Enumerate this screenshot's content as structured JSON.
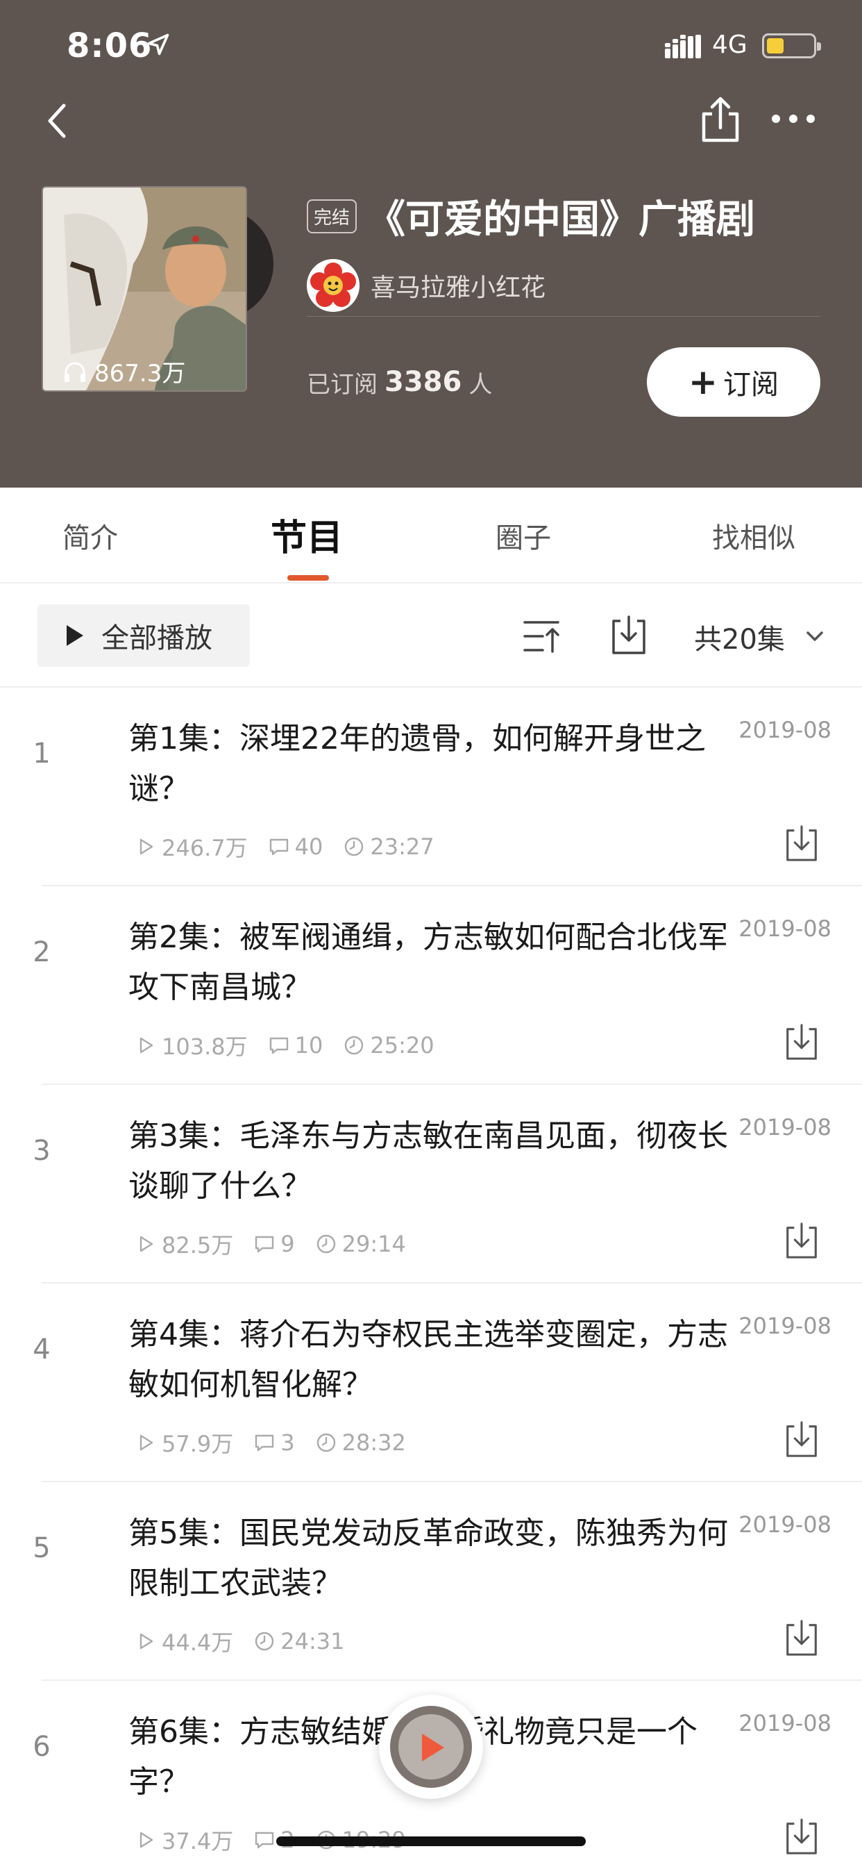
{
  "status_bar": {
    "time": "8:06",
    "network": "4G"
  },
  "album": {
    "status_badge": "完结",
    "title": "《可爱的中国》广播剧",
    "author": "喜马拉雅小红花",
    "plays": "867.3万",
    "subscribed_label": "已订阅",
    "subscribed_count": "3386",
    "subscribed_unit": "人",
    "subscribe_button": "订阅"
  },
  "tabs": [
    {
      "label": "简介"
    },
    {
      "label": "节目",
      "active": true
    },
    {
      "label": "圈子"
    },
    {
      "label": "找相似"
    }
  ],
  "toolbar": {
    "play_all": "全部播放",
    "episode_count": "共20集"
  },
  "episodes": [
    {
      "index": "1",
      "title": "第1集：深埋22年的遗骨，如何解开身世之谜？",
      "date": "2019-08",
      "plays": "246.7万",
      "comments": "40",
      "duration": "23:27"
    },
    {
      "index": "2",
      "title": "第2集：被军阀通缉，方志敏如何配合北伐军攻下南昌城？",
      "date": "2019-08",
      "plays": "103.8万",
      "comments": "10",
      "duration": "25:20"
    },
    {
      "index": "3",
      "title": "第3集：毛泽东与方志敏在南昌见面，彻夜长谈聊了什么？",
      "date": "2019-08",
      "plays": "82.5万",
      "comments": "9",
      "duration": "29:14"
    },
    {
      "index": "4",
      "title": "第4集：蒋介石为夺权民主选举变圈定，方志敏如何机智化解？",
      "date": "2019-08",
      "plays": "57.9万",
      "comments": "3",
      "duration": "28:32"
    },
    {
      "index": "5",
      "title": "第5集：国民党发动反革命政变，陈独秀为何限制工农武装？",
      "date": "2019-08",
      "plays": "44.4万",
      "duration": "24:31"
    },
    {
      "index": "6",
      "title": "第6集：方志敏结婚，新婚礼物竟只是一个字？",
      "date": "2019-08",
      "plays": "37.4万",
      "comments": "2",
      "duration": "19:29"
    }
  ]
}
